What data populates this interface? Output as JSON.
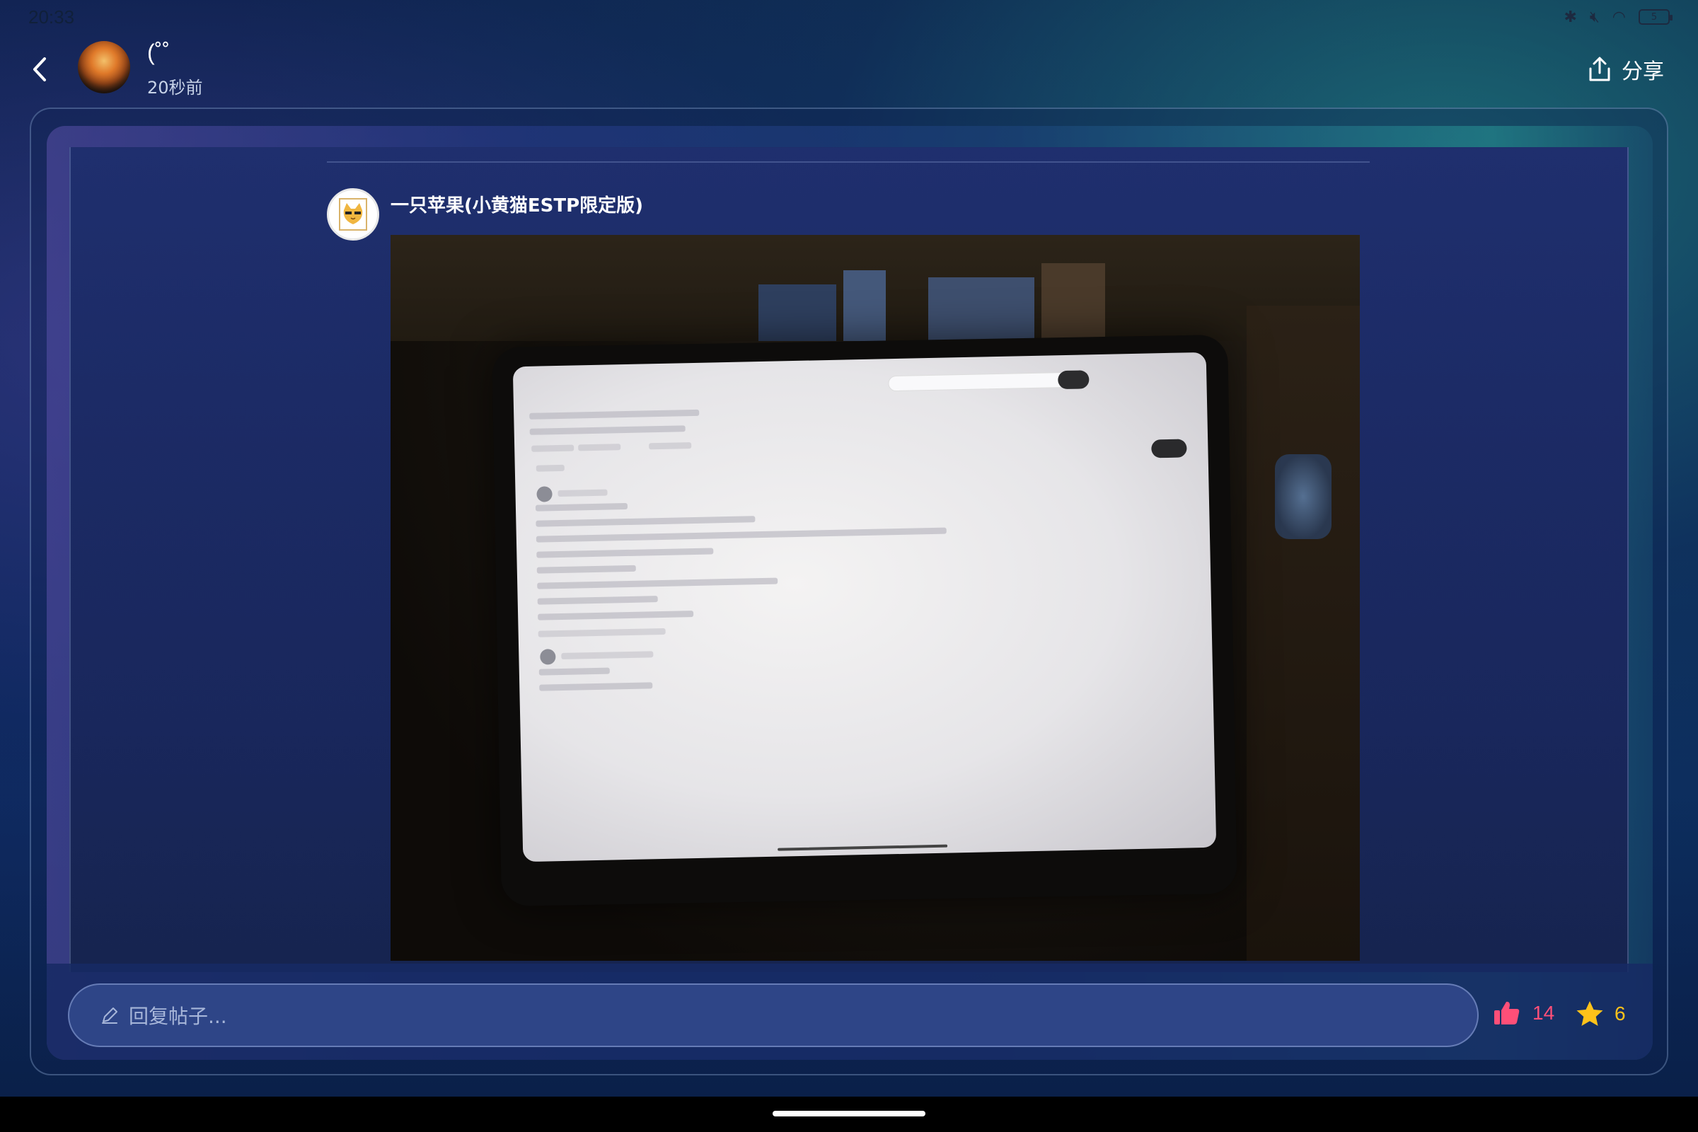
{
  "status_bar": {
    "time": "20:33",
    "battery": "5"
  },
  "header": {
    "user_name": "(˚˚",
    "post_time": "20秒前",
    "share_label": "分享"
  },
  "post": {
    "author_name": "一只苹果(小黄猫ESTP限定版)"
  },
  "reply_bar": {
    "placeholder": "回复帖子...",
    "like_count": "14",
    "favorite_count": "6"
  },
  "colors": {
    "like": "#ff4f78",
    "favorite": "#ffc21a",
    "input_bg": "#2e4587"
  },
  "icons": [
    "back-icon",
    "share-icon",
    "pencil-icon",
    "thumbs-up-icon",
    "star-icon",
    "bluetooth-icon",
    "mute-icon",
    "wifi-icon",
    "battery-icon"
  ]
}
